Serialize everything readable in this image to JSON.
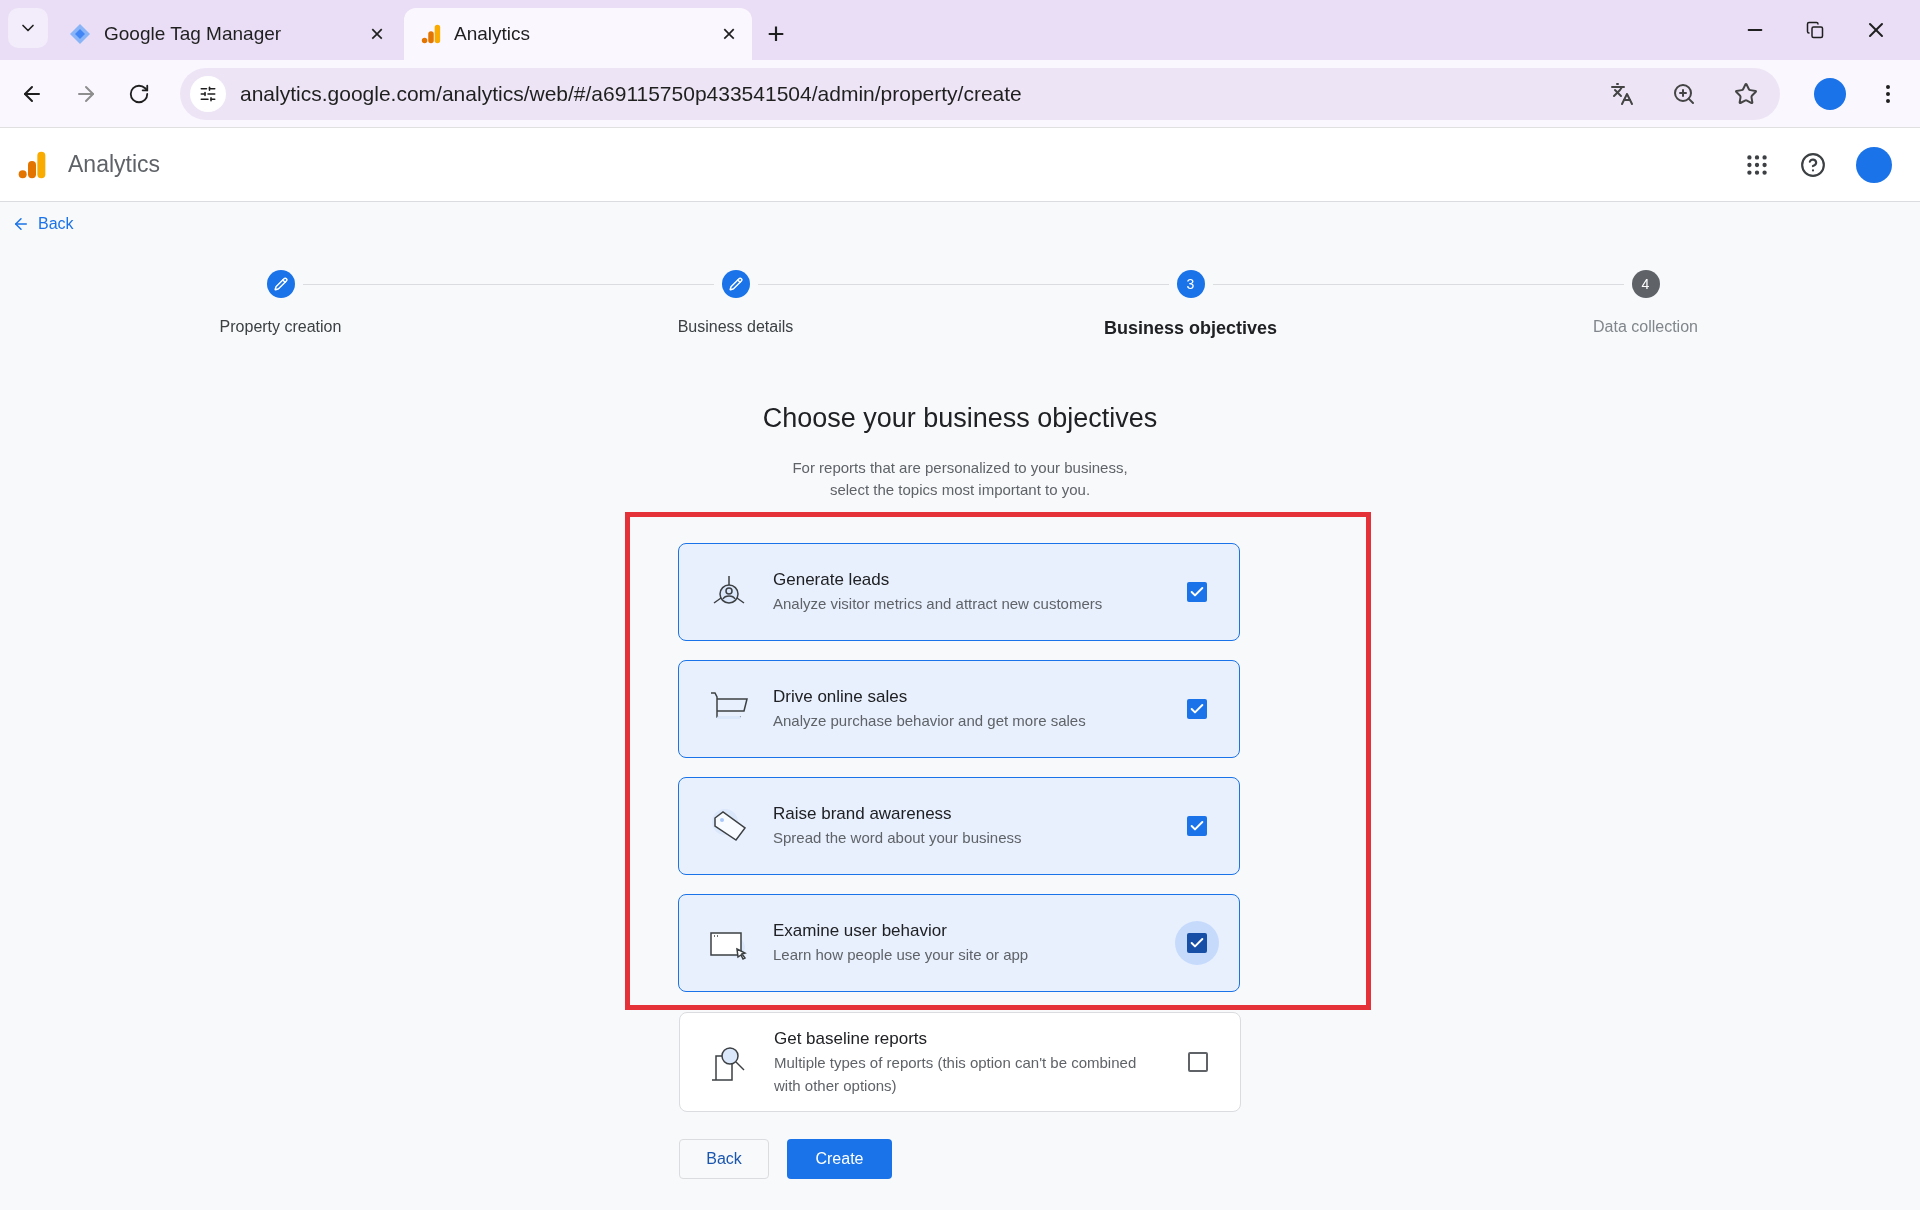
{
  "browser": {
    "tabs": [
      {
        "title": "Google Tag Manager",
        "close": "×",
        "selected": false
      },
      {
        "title": "Analytics",
        "close": "×",
        "selected": true
      }
    ],
    "new_tab": "+",
    "url": "analytics.google.com/analytics/web/#/a69115750p433541504/admin/property/create"
  },
  "app": {
    "name": "Analytics"
  },
  "back_link": "Back",
  "steps": [
    {
      "label": "Property creation",
      "completed": true,
      "selected": false
    },
    {
      "label": "Business details",
      "completed": true,
      "selected": false
    },
    {
      "number": "3",
      "label": "Business objectives",
      "completed": false,
      "selected": true
    },
    {
      "number": "4",
      "label": "Data collection",
      "completed": false,
      "selected": false
    }
  ],
  "heading": "Choose your business objectives",
  "subtitle": [
    "For reports that are personalized to your business,",
    "select the topics most important to you."
  ],
  "objectives": [
    {
      "title": "Generate leads",
      "description": "Analyze visitor metrics and attract new customers",
      "checked": true,
      "focused": false
    },
    {
      "title": "Drive online sales",
      "description": "Analyze purchase behavior and get more sales",
      "checked": true,
      "focused": false
    },
    {
      "title": "Raise brand awareness",
      "description": "Spread the word about your business",
      "checked": true,
      "focused": false
    },
    {
      "title": "Examine user behavior",
      "description": "Learn how people use your site or app",
      "checked": true,
      "focused": true
    }
  ],
  "baseline": {
    "title": "Get baseline reports",
    "description": "Multiple types of reports (this option can't be combined with other options)",
    "checked": false,
    "focused": false
  },
  "buttons": [
    {
      "label": "Back",
      "kind": "secondary"
    },
    {
      "label": "Create",
      "kind": "primary"
    }
  ]
}
